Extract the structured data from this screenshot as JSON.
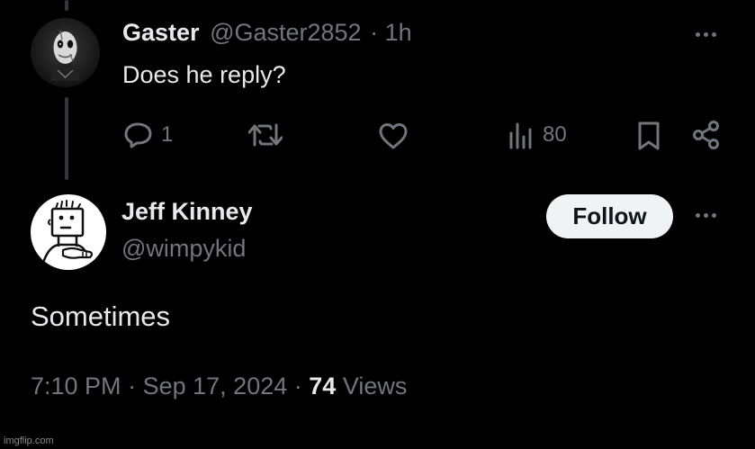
{
  "parent_tweet": {
    "display_name": "Gaster",
    "handle": "@Gaster2852",
    "separator": "·",
    "time_ago": "1h",
    "text": "Does he reply?",
    "reply_count": "1",
    "view_count": "80",
    "icons": [
      "reply-icon",
      "retweet-icon",
      "like-icon",
      "views-icon",
      "bookmark-icon",
      "share-icon",
      "more-icon"
    ]
  },
  "main_tweet": {
    "display_name": "Jeff Kinney",
    "handle": "@wimpykid",
    "follow_label": "Follow",
    "text": "Sometimes",
    "time": "7:10 PM",
    "date": "Sep 17, 2024",
    "separator": "·",
    "views_count": "74",
    "views_label": "Views"
  },
  "watermark": "imgflip.com",
  "colors": {
    "background": "#000000",
    "primary_text": "#e7e9ea",
    "secondary_text": "#71767b",
    "button_bg": "#eff3f4"
  }
}
